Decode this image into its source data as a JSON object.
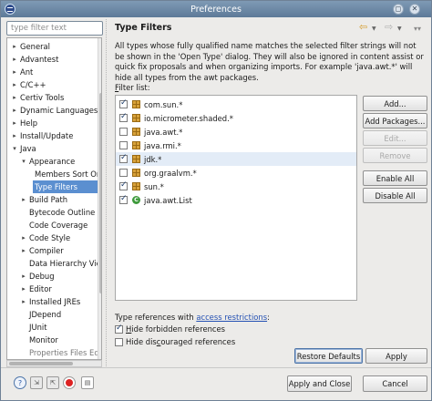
{
  "window": {
    "title": "Preferences"
  },
  "filter": {
    "placeholder": "type filter text"
  },
  "tree": {
    "items": [
      {
        "label": "General",
        "twisty": "▸"
      },
      {
        "label": "Advantest",
        "twisty": "▸"
      },
      {
        "label": "Ant",
        "twisty": "▸"
      },
      {
        "label": "C/C++",
        "twisty": "▸"
      },
      {
        "label": "Certiv Tools",
        "twisty": "▸"
      },
      {
        "label": "Dynamic Languages",
        "twisty": "▸"
      },
      {
        "label": "Help",
        "twisty": "▸"
      },
      {
        "label": "Install/Update",
        "twisty": "▸"
      },
      {
        "label": "Java",
        "twisty": "▾"
      },
      {
        "label": "Appearance",
        "twisty": "▾"
      },
      {
        "label": "Members Sort Order",
        "twisty": ""
      },
      {
        "label": "Type Filters",
        "twisty": ""
      },
      {
        "label": "Build Path",
        "twisty": "▸"
      },
      {
        "label": "Bytecode Outline",
        "twisty": ""
      },
      {
        "label": "Code Coverage",
        "twisty": ""
      },
      {
        "label": "Code Style",
        "twisty": "▸"
      },
      {
        "label": "Compiler",
        "twisty": "▸"
      },
      {
        "label": "Data Hierarchy View",
        "twisty": ""
      },
      {
        "label": "Debug",
        "twisty": "▸"
      },
      {
        "label": "Editor",
        "twisty": "▸"
      },
      {
        "label": "Installed JREs",
        "twisty": "▸"
      },
      {
        "label": "JDepend",
        "twisty": ""
      },
      {
        "label": "JUnit",
        "twisty": ""
      },
      {
        "label": "Monitor",
        "twisty": ""
      },
      {
        "label": "Properties Files Editor",
        "twisty": ""
      }
    ]
  },
  "page": {
    "title": "Type Filters",
    "description": "All types whose fully qualified name matches the selected filter strings will not be shown in the 'Open Type' dialog. They will also be ignored in content assist or quick fix proposals and when organizing imports. For example 'java.awt.*' will hide all types from the awt packages.",
    "list_label_mnemonic": "F",
    "list_label_rest": "ilter list:"
  },
  "filters": [
    {
      "name": "com.sun.*",
      "checked": true,
      "icon": "package-icon"
    },
    {
      "name": "io.micrometer.shaded.*",
      "checked": true,
      "icon": "package-icon"
    },
    {
      "name": "java.awt.*",
      "checked": false,
      "icon": "package-icon"
    },
    {
      "name": "java.rmi.*",
      "checked": false,
      "icon": "package-icon"
    },
    {
      "name": "jdk.*",
      "checked": true,
      "icon": "package-icon"
    },
    {
      "name": "org.graalvm.*",
      "checked": false,
      "icon": "package-icon"
    },
    {
      "name": "sun.*",
      "checked": true,
      "icon": "package-icon"
    },
    {
      "name": "java.awt.List",
      "checked": true,
      "icon": "class-icon"
    }
  ],
  "buttons": {
    "add": "Add...",
    "add_packages": "Add Packages...",
    "edit": "Edit...",
    "remove": "Remove",
    "enable_all": "Enable All",
    "disable_all": "Disable All",
    "restore_defaults": "Restore Defaults",
    "apply": "Apply",
    "apply_and_close": "Apply and Close",
    "cancel": "Cancel"
  },
  "restrictions": {
    "prefix": "Type references with ",
    "link": "access restrictions",
    "suffix": ":",
    "hide_forbidden_mnemonic": "H",
    "hide_forbidden_rest": "ide forbidden references",
    "hide_forbidden_checked": true,
    "hide_discouraged_pre": "Hide dis",
    "hide_discouraged_mnemonic": "c",
    "hide_discouraged_rest": "ouraged references",
    "hide_discouraged_checked": false
  },
  "colors": {
    "selection": "#5b8fd0",
    "link": "#2450b3",
    "titlebar": "#6f8aa8"
  }
}
